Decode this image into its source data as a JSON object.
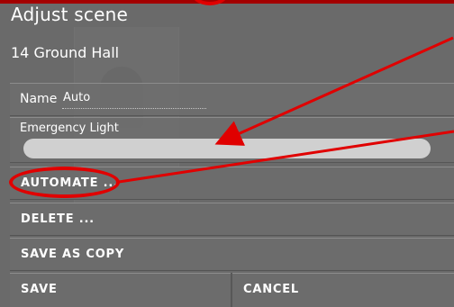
{
  "dialog": {
    "title": "Adjust scene",
    "subtitle": "14 Ground Hall"
  },
  "form": {
    "name_label": "Name",
    "name_value": "Auto",
    "emergency_label": "Emergency Light"
  },
  "buttons": {
    "automate": "AUTOMATE ...",
    "delete": "DELETE ...",
    "save_as_copy": "SAVE AS COPY",
    "save": "SAVE",
    "cancel": "CANCEL"
  },
  "colors": {
    "annotation": "#e00000",
    "slider": "#d0d0d0"
  }
}
